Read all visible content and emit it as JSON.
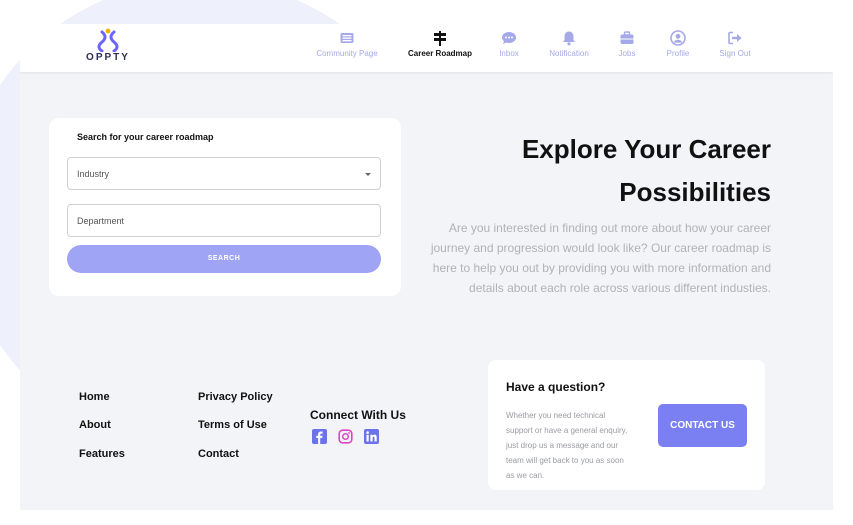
{
  "brand": {
    "name": "OPPTY"
  },
  "nav": [
    {
      "label": "Community Page",
      "icon": "newspaper-icon",
      "active": false
    },
    {
      "label": "Career Roadmap",
      "icon": "signpost-icon",
      "active": true
    },
    {
      "label": "Inbox",
      "icon": "chat-icon",
      "active": false
    },
    {
      "label": "Notification",
      "icon": "bell-icon",
      "active": false
    },
    {
      "label": "Jobs",
      "icon": "briefcase-icon",
      "active": false
    },
    {
      "label": "Profile",
      "icon": "user-circle-icon",
      "active": false
    },
    {
      "label": "Sign Out",
      "icon": "sign-out-icon",
      "active": false
    }
  ],
  "search": {
    "title": "Search for your career roadmap",
    "industry_label": "Industry",
    "department_label": "Department",
    "button": "SEARCH"
  },
  "hero": {
    "title_line1": "Explore Your Career",
    "title_line2": "Possibilities",
    "description": "Are you interested in finding out more about how your career journey and progression would look like? Our career roadmap is here to help you out by providing you with more information and details about each role across various different industies."
  },
  "footer": {
    "col1": [
      "Home",
      "About",
      "Features"
    ],
    "col2": [
      "Privacy Policy",
      "Terms of Use",
      "Contact"
    ],
    "connect_title": "Connect With Us",
    "socials": [
      "facebook-icon",
      "instagram-icon",
      "linkedin-icon"
    ]
  },
  "question": {
    "title": "Have a question?",
    "text": "Whether you need technical support or have a general enquiry, just drop us a message and our team will get back to you as soon as we can.",
    "button": "CONTACT US"
  },
  "colors": {
    "accent": "#7a80f2",
    "accent_light": "#9fa4f5",
    "nav_inactive": "#a5a9e8",
    "page_bg": "#f3f4f7"
  }
}
